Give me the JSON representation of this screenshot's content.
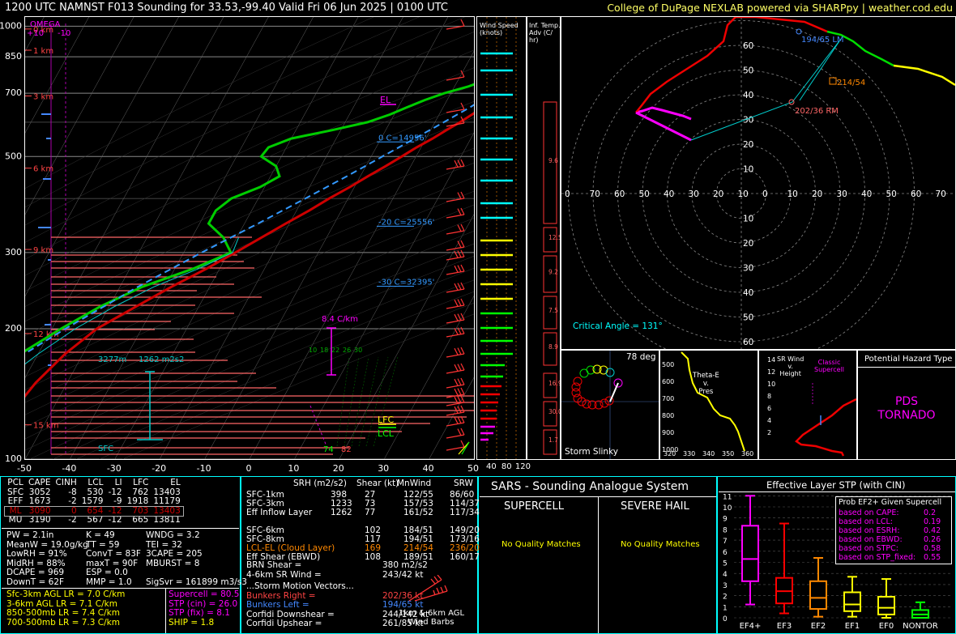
{
  "header": {
    "title": "1200 UTC NAMNST F013 Sounding for 33.53,-99.40 Valid  Fri 06 Jun 2025 | 0100 UTC",
    "credit": "College of DuPage NEXLAB powered via SHARPpy | weather.cod.edu"
  },
  "skewt": {
    "p_ticks": [
      {
        "p": 100,
        "label": "100"
      },
      {
        "p": 200,
        "label": "200"
      },
      {
        "p": 300,
        "label": "300"
      },
      {
        "p": 500,
        "label": "500"
      },
      {
        "p": 700,
        "label": "700"
      },
      {
        "p": 850,
        "label": "850"
      },
      {
        "p": 1000,
        "label": "1000"
      }
    ],
    "t_ticks": [
      "-50",
      "-40",
      "-30",
      "-20",
      "-10",
      "0",
      "10",
      "20",
      "30",
      "40",
      "50"
    ],
    "t_values": [
      -50,
      -40,
      -30,
      -20,
      -10,
      0,
      10,
      20,
      30,
      40,
      50
    ],
    "omega": {
      "label": "OMEGA",
      "left": "+10",
      "right": "-10"
    },
    "heights": [
      "15 km",
      "12 km",
      "9 km",
      "6 km",
      "3 km",
      "1 km",
      "0 km"
    ],
    "height_p": [
      120,
      195,
      305,
      470,
      690,
      880,
      985
    ],
    "el_label": "EL",
    "lfc_label": "LFC",
    "lcl_label": "LCL",
    "iso_labels": [
      "-30 C=32395'",
      "-20 C=25556'",
      "0 C=14956'"
    ],
    "iso_p": [
      253,
      348,
      545
    ],
    "lr_label": "8.4 C/km",
    "eff_depth": "3277m",
    "eff_srh": "1262 m2s2",
    "sfc_label": "SFC",
    "sfc_t": "82",
    "sfc_td": "74",
    "wetbulb_ticks": [
      "10",
      "18",
      "22",
      "26",
      "30"
    ]
  },
  "chart_data": {
    "type": "line",
    "xlabel": "",
    "ylabel": "",
    "xlim": [
      -50,
      50
    ],
    "ylim": [
      1050,
      100
    ],
    "series": [
      {
        "p": [
          1000,
          975,
          950,
          925,
          900,
          875,
          850,
          825,
          800,
          775,
          750,
          725,
          700,
          675,
          650,
          625,
          600,
          575,
          550,
          525,
          500,
          475,
          450,
          425,
          400,
          375,
          350,
          325,
          300,
          275,
          250,
          225,
          200,
          175,
          150,
          125,
          100
        ],
        "values": [
          27.8,
          28,
          26,
          24,
          23,
          22,
          20.2,
          20,
          19.3,
          18.6,
          16.5,
          14.5,
          12.4,
          10.7,
          9,
          7.3,
          5.6,
          3.5,
          1.5,
          -1,
          -3.2,
          -5.6,
          -8.3,
          -11,
          -14.2,
          -17.2,
          -20.8,
          -24.5,
          -28.5,
          -33,
          -38.5,
          -44,
          -50,
          -54,
          -57,
          -59,
          -61
        ]
      },
      {
        "p": [
          1000,
          975,
          950,
          925,
          900,
          875,
          850,
          825,
          800,
          775,
          750,
          725,
          700,
          675,
          650,
          625,
          600,
          575,
          550,
          525,
          500,
          475,
          450,
          425,
          400,
          375,
          350,
          325,
          300,
          275,
          250,
          225,
          200,
          175,
          150,
          125,
          100
        ],
        "values": [
          23.3,
          22,
          21,
          19.5,
          18.5,
          17.5,
          15,
          12.5,
          10.5,
          8.3,
          6,
          3,
          -1.5,
          -5,
          -8,
          -11,
          -15,
          -22,
          -30,
          -34,
          -34.5,
          -30,
          -28,
          -31,
          -36,
          -38,
          -38,
          -33,
          -29.5,
          -36,
          -45,
          -52,
          -58,
          -64,
          -70,
          -76,
          -82
        ]
      },
      {
        "p": [
          1000,
          950,
          900,
          850,
          800,
          750,
          700,
          650,
          600,
          550,
          500,
          450,
          400,
          350,
          300,
          250,
          200,
          150,
          100
        ],
        "values": [
          28,
          25.2,
          22.2,
          19,
          16,
          13,
          9.5,
          6,
          2,
          -2.5,
          -7.5,
          -13,
          -19.5,
          -27,
          -36,
          -46,
          -57,
          -70,
          -86
        ]
      }
    ]
  },
  "hodograph": {
    "rings": [
      "10",
      "20",
      "30",
      "40",
      "50",
      "60"
    ],
    "axis": [
      "0",
      "70",
      "60",
      "50",
      "40",
      "30",
      "20",
      "10",
      "0",
      "10",
      "20",
      "30",
      "40",
      "50",
      "60",
      "70"
    ],
    "lm_label": "194/65 LM",
    "mean_label": "214/54",
    "rm_label": "202/36 RM",
    "crit_angle": "Critical Angle = 131°"
  },
  "barbs_panel": {
    "title": "Wind Speed\n(knots)",
    "ticks": [
      "40",
      "80",
      "120"
    ]
  },
  "adv_panel": {
    "title": "Inf. Temp.\nAdv (C/\nhr)",
    "values": [
      "9.6",
      "12.5",
      "9.2",
      "7.5",
      "8.9",
      "16.9",
      "30.0",
      "1.7"
    ]
  },
  "slinky": {
    "label": "Storm Slinky",
    "deg": "78 deg"
  },
  "theta": {
    "title": "Theta-E\nv.\nPres",
    "y_ticks": [
      "500",
      "600",
      "700",
      "800",
      "900",
      "1000"
    ],
    "x_ticks": [
      "320",
      "330",
      "340",
      "350",
      "360"
    ]
  },
  "srwind": {
    "title": "SR Wind\nv.\nHeight",
    "classic": "Classic\nSupercell",
    "y_ticks": [
      "14",
      "12",
      "10",
      "8",
      "6",
      "4",
      "2"
    ]
  },
  "hazard": {
    "title": "Potential Hazard Type",
    "value": "PDS\nTORNADO",
    "color": "#ff00ff"
  },
  "parcels": {
    "headers": [
      "PCL",
      "CAPE",
      "CINH",
      "LCL",
      "LI",
      "LFC",
      "EL"
    ],
    "rows": [
      [
        "SFC",
        "3052",
        "-8",
        "530",
        "-12",
        "762",
        "13403"
      ],
      [
        "EFF",
        "1673",
        "-2",
        "1579",
        "-9",
        "1918",
        "11179"
      ],
      [
        "ML",
        "3090",
        "0",
        "654",
        "-12",
        "703",
        "13403"
      ],
      [
        "MU",
        "3190",
        "-2",
        "567",
        "-12",
        "665",
        "13811"
      ]
    ]
  },
  "indices": {
    "col1": [
      "PW = 2.1in",
      "MeanW = 19.0g/kg",
      "LowRH = 91%",
      "MidRH = 88%",
      "DCAPE = 969",
      "DownT = 62F"
    ],
    "col2": [
      "K = 49",
      "TT = 59",
      "ConvT = 83F",
      "maxT = 90F",
      "ESP = 0.0",
      "MMP = 1.0"
    ],
    "col3": [
      "WNDG = 3.2",
      "TEI = 32",
      "3CAPE = 205",
      "MBURST = 8",
      "",
      ""
    ],
    "sigsvr": "SigSvr = 161899 m3/s3"
  },
  "lapse": [
    "Sfc-3km AGL LR = 7.0 C/km",
    "3-6km AGL LR = 7.1 C/km",
    "850-500mb LR = 7.4 C/km",
    "700-500mb LR = 7.3 C/km"
  ],
  "composites": [
    "Supercell = 80.5",
    "STP (cin) = 26.0",
    "STP (fix) = 8.1",
    "SHIP = 1.8"
  ],
  "kinematics": {
    "headers": [
      "SRH (m2/s2)",
      "Shear (kt)",
      "MnWind",
      "SRW"
    ],
    "rows": [
      [
        "SFC-1km",
        "398",
        "27",
        "122/55",
        "86/60"
      ],
      [
        "SFC-3km",
        "1233",
        "73",
        "157/53",
        "114/37"
      ],
      [
        "Eff Inflow Layer",
        "1262",
        "77",
        "161/52",
        "117/34"
      ],
      [
        "",
        "",
        "",
        "",
        ""
      ],
      [
        "SFC-6km",
        "",
        "102",
        "184/51",
        "149/20"
      ],
      [
        "SFC-8km",
        "",
        "117",
        "194/51",
        "173/16"
      ],
      [
        "LCL-EL (Cloud Layer)",
        "",
        "169",
        "214/54",
        "236/20"
      ],
      [
        "Eff Shear (EBWD)",
        "",
        "108",
        "189/51",
        "160/17"
      ]
    ],
    "brn": [
      "BRN Shear =",
      "380 m2/s2"
    ],
    "wind46": [
      "4-6km SR Wind =",
      "243/42 kt"
    ],
    "motion_title": "...Storm Motion Vectors...",
    "motion": [
      [
        "Bunkers Right =",
        "202/36 kt"
      ],
      [
        "Bunkers Left =",
        "194/65 kt"
      ],
      [
        "Corfidi Downshear =",
        "244/142 kt"
      ],
      [
        "Corfidi Upshear =",
        "261/85 kt"
      ]
    ],
    "barbs_label": "1km & 6km AGL\nWind Barbs"
  },
  "sars": {
    "title": "SARS - Sounding Analogue System",
    "supercell": "SUPERCELL",
    "hail": "SEVERE HAIL",
    "nomatch1": "No Quality Matches",
    "nomatch2": "No Quality Matches"
  },
  "stp": {
    "title": "Effective Layer STP (with CIN)",
    "y_ticks": [
      "11",
      "10",
      "9",
      "8",
      "7",
      "6",
      "5",
      "4",
      "3",
      "2",
      "1",
      "0"
    ],
    "categories": [
      "EF4+",
      "EF3",
      "EF2",
      "EF1",
      "EF0",
      "NONTOR"
    ],
    "boxes": [
      {
        "lo": 1.2,
        "q1": 3.3,
        "med": 5.3,
        "q3": 8.3,
        "hi": 11,
        "color": "#ff00ff"
      },
      {
        "lo": 0.4,
        "q1": 1.3,
        "med": 2.4,
        "q3": 3.6,
        "hi": 8.5,
        "color": "#ff0000"
      },
      {
        "lo": 0.1,
        "q1": 0.8,
        "med": 1.8,
        "q3": 3.3,
        "hi": 5.4,
        "color": "#ff8800"
      },
      {
        "lo": 0.1,
        "q1": 0.6,
        "med": 1.2,
        "q3": 2.3,
        "hi": 3.7,
        "color": "#ffff00"
      },
      {
        "lo": 0,
        "q1": 0.3,
        "med": 0.9,
        "q3": 1.9,
        "hi": 3.5,
        "color": "#ffff00"
      },
      {
        "lo": 0,
        "q1": 0,
        "med": 0.3,
        "q3": 0.7,
        "hi": 1.4,
        "color": "#00ff00"
      }
    ],
    "prob_title": "Prob EF2+ Given Supercell",
    "prob": [
      [
        "based on CAPE:",
        "0.2"
      ],
      [
        "based on LCL:",
        "0.19"
      ],
      [
        "based on ESRH:",
        "0.42"
      ],
      [
        "based on EBWD:",
        "0.26"
      ],
      [
        "based on STPC:",
        "0.58"
      ],
      [
        "based on STP_fixed:",
        "0.55"
      ]
    ]
  }
}
